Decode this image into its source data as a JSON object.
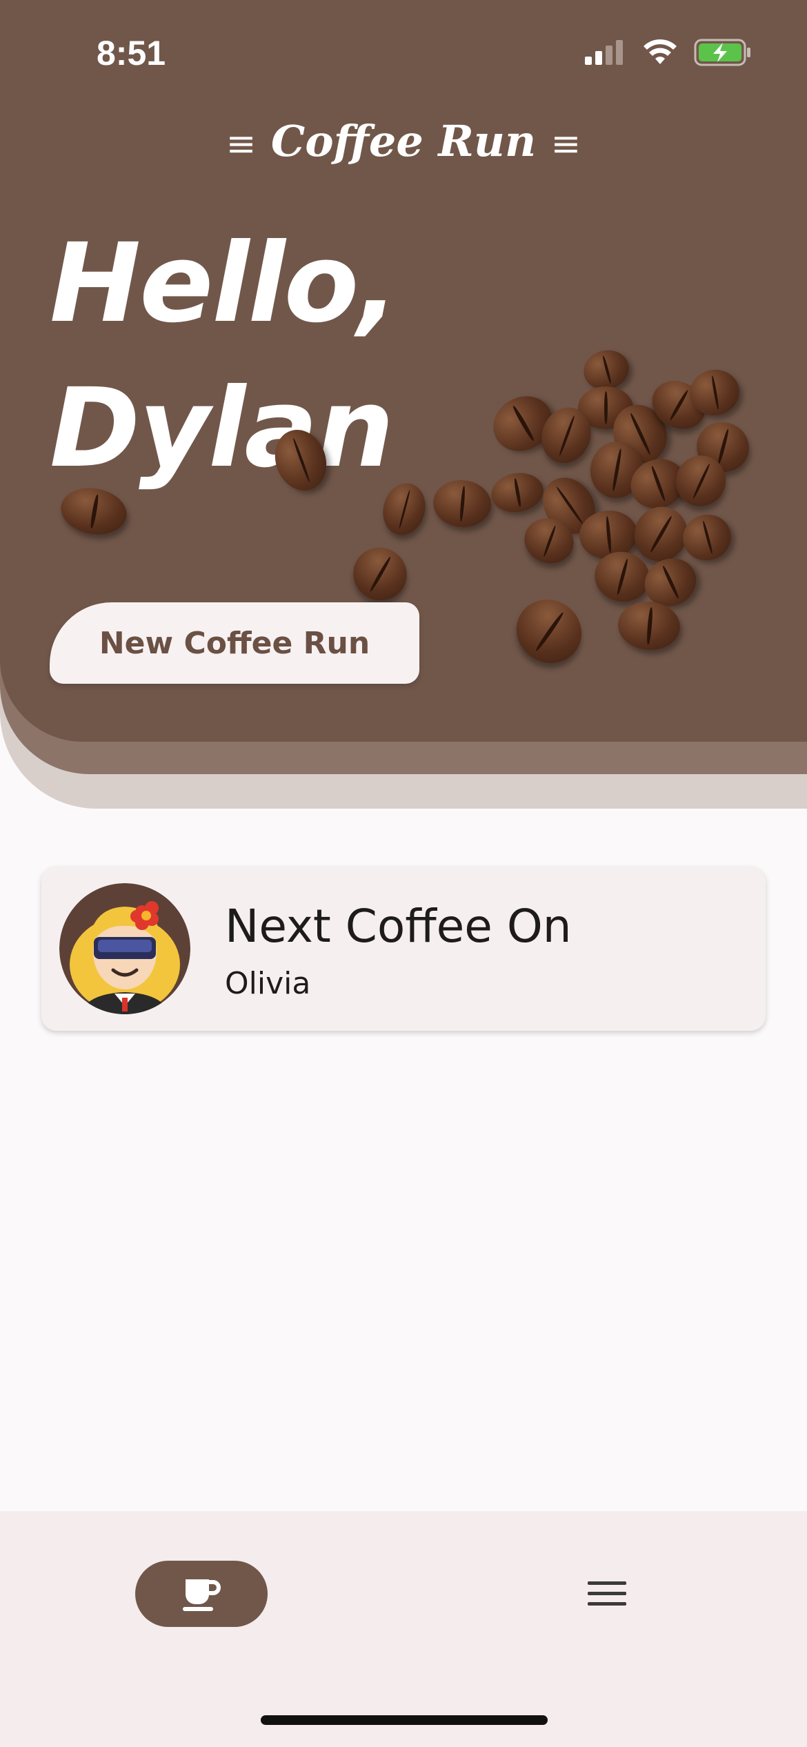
{
  "status_bar": {
    "time": "8:51"
  },
  "header": {
    "logo": "Coffee Run",
    "greeting_line1": "Hello,",
    "greeting_line2": "Dylan",
    "new_run_button": "New Coffee Run"
  },
  "next_coffee_card": {
    "title": "Next Coffee On",
    "person": "Olivia"
  },
  "bottom_nav": {
    "items": [
      {
        "icon": "coffee-cup-icon",
        "selected": true
      },
      {
        "icon": "menu-icon",
        "selected": false
      }
    ]
  },
  "colors": {
    "header_brown": "#71574A",
    "header_mid": "#8C7469",
    "header_light": "#D8CFCB",
    "background": "#FCF9FB",
    "card": "#F5EFF0",
    "battery_green": "#5BC34A"
  }
}
